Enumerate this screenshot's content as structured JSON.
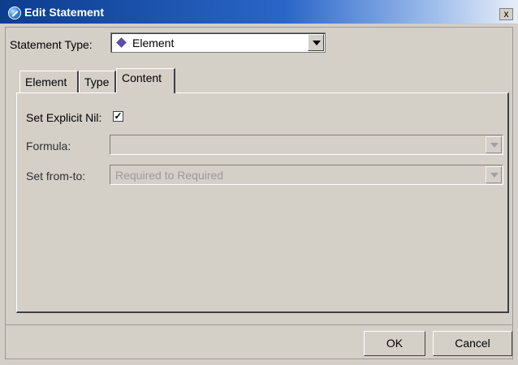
{
  "window": {
    "title": "Edit Statement",
    "close_glyph": "x",
    "icon": "app-globe-icon"
  },
  "statement_type": {
    "label": "Statement Type:",
    "value": "Element",
    "icon": "diamond-icon",
    "icon_color": "#5a4fa8"
  },
  "tabs": [
    {
      "label": "Element",
      "active": false
    },
    {
      "label": "Type",
      "active": false
    },
    {
      "label": "Content",
      "active": true
    }
  ],
  "content": {
    "explicit_nil": {
      "label": "Set Explicit Nil:",
      "checked": true,
      "check_glyph": "✓"
    },
    "formula": {
      "label": "Formula:",
      "value": "",
      "enabled": false
    },
    "set_from_to": {
      "label": "Set from-to:",
      "value": "Required to Required",
      "enabled": false
    }
  },
  "buttons": {
    "ok": "OK",
    "cancel": "Cancel"
  }
}
